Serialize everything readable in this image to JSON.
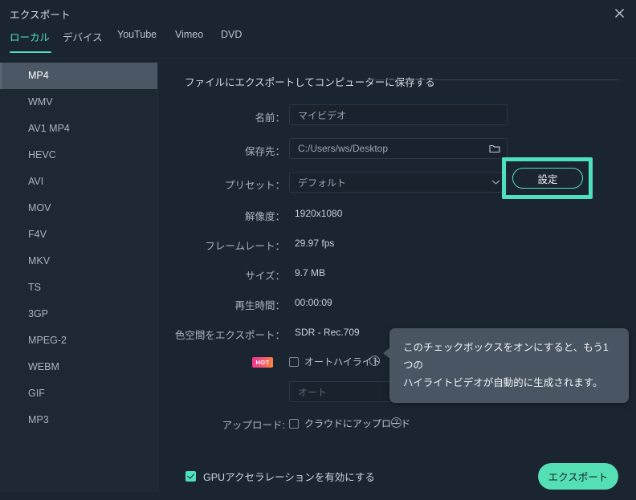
{
  "window": {
    "title": "エクスポート",
    "close_icon": "close-icon"
  },
  "tabs": [
    {
      "label": "ローカル",
      "active": true
    },
    {
      "label": "デバイス",
      "active": false
    },
    {
      "label": "YouTube",
      "active": false
    },
    {
      "label": "Vimeo",
      "active": false
    },
    {
      "label": "DVD",
      "active": false
    }
  ],
  "sidebar": {
    "items": [
      {
        "label": "MP4",
        "selected": true
      },
      {
        "label": "WMV",
        "selected": false
      },
      {
        "label": "AV1 MP4",
        "selected": false
      },
      {
        "label": "HEVC",
        "selected": false
      },
      {
        "label": "AVI",
        "selected": false
      },
      {
        "label": "MOV",
        "selected": false
      },
      {
        "label": "F4V",
        "selected": false
      },
      {
        "label": "MKV",
        "selected": false
      },
      {
        "label": "TS",
        "selected": false
      },
      {
        "label": "3GP",
        "selected": false
      },
      {
        "label": "MPEG-2",
        "selected": false
      },
      {
        "label": "WEBM",
        "selected": false
      },
      {
        "label": "GIF",
        "selected": false
      },
      {
        "label": "MP3",
        "selected": false
      }
    ]
  },
  "main": {
    "section_title": "ファイルにエクスポートしてコンピューターに保存する",
    "name": {
      "label": "名前：",
      "value": "マイビデオ"
    },
    "destination": {
      "label": "保存先：",
      "value": "C:/Users/ws/Desktop",
      "icon": "folder-icon"
    },
    "preset": {
      "label": "プリセット：",
      "value": "デフォルト",
      "icon": "chevron-down-icon"
    },
    "settings_button": {
      "label": "設定"
    },
    "resolution": {
      "label": "解像度：",
      "value": "1920x1080"
    },
    "framerate": {
      "label": "フレームレート：",
      "value": "29.97 fps"
    },
    "size": {
      "label": "サイズ：",
      "value": "9.7 MB"
    },
    "duration": {
      "label": "再生時間：",
      "value": "00:00:09"
    },
    "color_space": {
      "label": "色空間をエクスポート：",
      "value": "SDR - Rec.709"
    },
    "auto_highlight": {
      "badge": "HOT",
      "label": "オートハイライト",
      "checked": false,
      "help_icon": "question-mark-icon"
    },
    "auto_highlight_mode": {
      "value": "オート",
      "icon": "chevron-down-icon",
      "disabled": true
    },
    "upload": {
      "label": "アップロード:",
      "checkbox_label": "クラウドにアップロード",
      "checked": false,
      "help_icon": "question-mark-icon"
    },
    "tooltip": {
      "line1": "このチェックボックスをオンにすると、もう1つの",
      "line2": "ハイライトビデオが自動的に生成されます。"
    }
  },
  "footer": {
    "gpu_label": "GPUアクセラレーションを有効にする",
    "gpu_checked": true,
    "export_label": "エクスポート"
  },
  "colors": {
    "accent": "#4fe0bd",
    "export_button": "#55dfb5",
    "background": "#1b2531",
    "sidebar": "#1e2835",
    "selected_row": "#4c5765",
    "tooltip": "#4a5563"
  }
}
